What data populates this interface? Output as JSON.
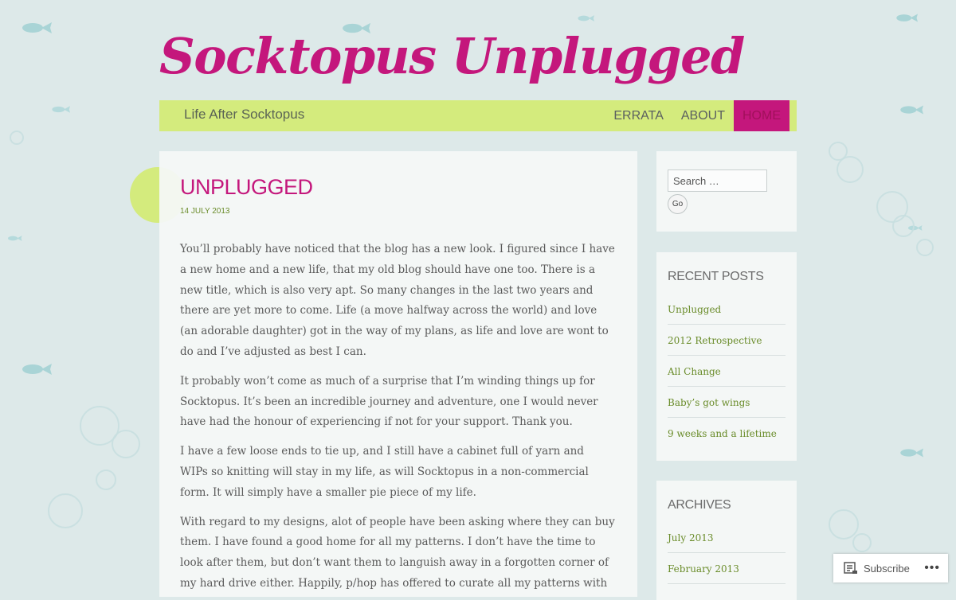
{
  "site": {
    "title": "Socktopus Unplugged",
    "tagline": "Life After Socktopus"
  },
  "nav": [
    {
      "label": "ERRATA",
      "active": false
    },
    {
      "label": "ABOUT",
      "active": false
    },
    {
      "label": "HOME",
      "active": true
    }
  ],
  "post": {
    "title": "UNPLUGGED",
    "date": "14 JULY 2013",
    "paragraphs": [
      "You’ll probably have noticed that the blog has a new look. I figured since I have a new home and a new life, that my old blog should have one too. There is a new title, which is also very apt.  So many changes in the last two years and there are yet more to come.  Life (a move halfway across the world) and love (an adorable daughter) got in the way of my plans, as life and love are wont to do and I’ve adjusted as best I can.",
      "It probably won’t come as much of a surprise that I’m winding things up for Socktopus. It’s been an incredible journey and adventure, one I would never have had the honour of experiencing if not for your support. Thank you.",
      "I have a few loose ends to tie up, and I still have a cabinet full of yarn and WIPs so knitting will stay in my life, as will Socktopus in a non-commercial form. It will simply have a smaller pie piece of my life.",
      "With regard to my designs, alot of people have been asking where they can buy them.  I have found a good home for all my patterns.  I don’t have the time to look after them, but don’t want them to languish away in a forgotten corner of my hard drive either. Happily, p/hop has offered to curate all my patterns with proceeds going towards Medicins Sans Frontier."
    ]
  },
  "search": {
    "placeholder": "Search …",
    "button_label": "Go"
  },
  "recent_posts": {
    "title": "RECENT POSTS",
    "items": [
      "Unplugged",
      "2012 Retrospective",
      "All Change",
      "Baby’s got wings",
      "9 weeks and a lifetime"
    ]
  },
  "archives": {
    "title": "ARCHIVES",
    "items": [
      "July 2013",
      "February 2013"
    ]
  },
  "subscribe": {
    "label": "Subscribe",
    "more": "•••"
  },
  "colors": {
    "accent": "#c4177c",
    "header_bar": "#d4eb7d",
    "link": "#6a8c2a",
    "background": "#dde9e9"
  },
  "icons": {
    "subscribe": "reader-icon",
    "more": "ellipsis-icon",
    "background": "fish-icon"
  }
}
